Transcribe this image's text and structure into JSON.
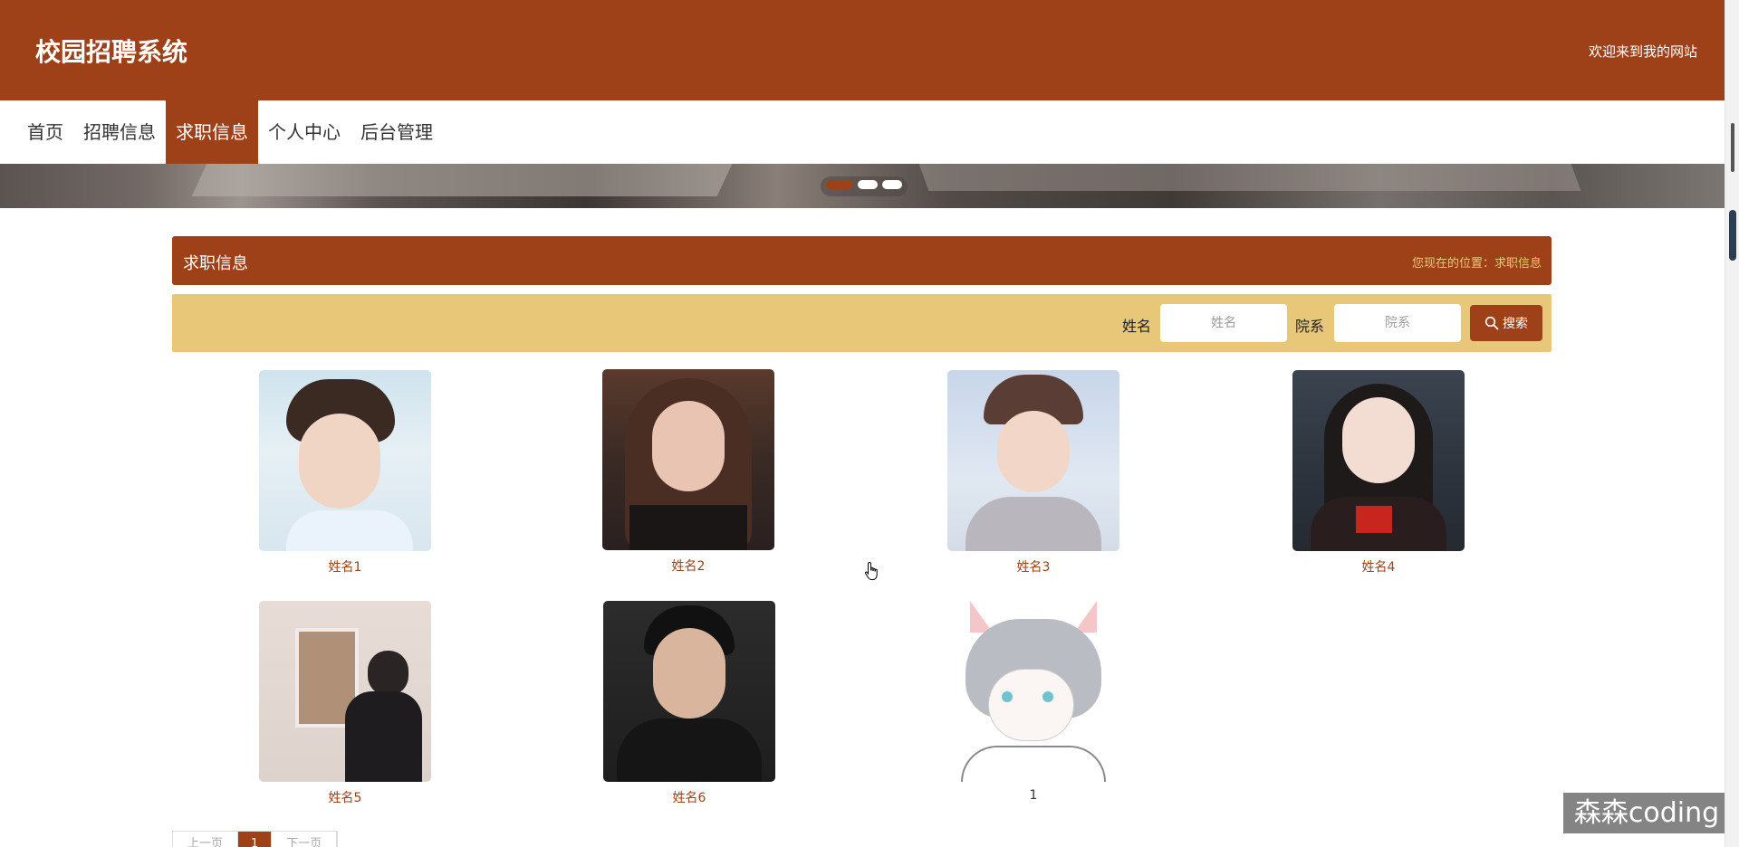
{
  "header": {
    "title": "校园招聘系统",
    "welcome": "欢迎来到我的网站"
  },
  "nav": {
    "items": [
      {
        "label": "首页",
        "active": false
      },
      {
        "label": "招聘信息",
        "active": false
      },
      {
        "label": "求职信息",
        "active": true
      },
      {
        "label": "个人中心",
        "active": false
      },
      {
        "label": "后台管理",
        "active": false
      }
    ]
  },
  "carousel": {
    "slide_count": 3,
    "active_index": 0
  },
  "page_bar": {
    "title": "求职信息",
    "location": "您现在的位置：求职信息"
  },
  "search": {
    "name_label": "姓名",
    "name_placeholder": "姓名",
    "dept_label": "院系",
    "dept_placeholder": "院系",
    "button_label": "搜索",
    "button_icon": "search-icon"
  },
  "cards": [
    {
      "name": "姓名1"
    },
    {
      "name": "姓名2"
    },
    {
      "name": "姓名3"
    },
    {
      "name": "姓名4"
    },
    {
      "name": "姓名5"
    },
    {
      "name": "姓名6"
    },
    {
      "name": "1"
    }
  ],
  "pagination": {
    "prev": "上一页",
    "current": "1",
    "next": "下一页"
  },
  "watermark": "森森coding",
  "colors": {
    "primary": "#9e4119",
    "search_bg": "#e8c878",
    "location_text": "#e8c878"
  }
}
